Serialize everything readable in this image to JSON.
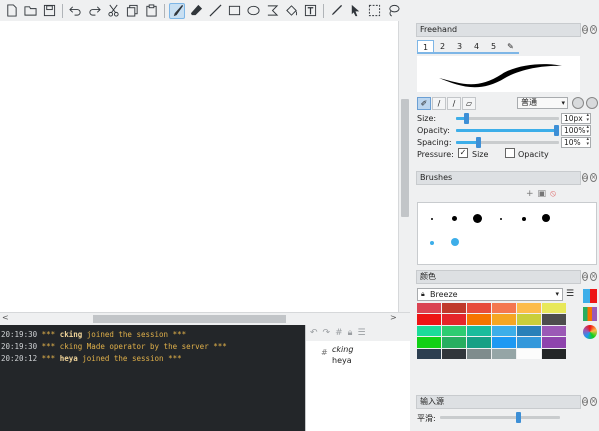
{
  "toolbar": {
    "items": [
      "new-document-icon",
      "open-folder-icon",
      "save-icon",
      "undo-icon",
      "redo-icon",
      "cut-icon",
      "copy-icon",
      "paste-icon",
      "freehand-brush-icon",
      "eraser-icon",
      "line-icon",
      "rectangle-icon",
      "ellipse-icon",
      "bezier-icon",
      "fill-bucket-icon",
      "text-icon",
      "color-picker-icon",
      "select-arrow-icon",
      "marquee-select-icon",
      "lasso-icon"
    ]
  },
  "chat": {
    "lines": [
      {
        "time": "20:19:30",
        "stars": "***",
        "user": "cking",
        "text": "joined the session",
        "end": "***"
      },
      {
        "time": "20:19:30",
        "stars": "***",
        "user": "",
        "text": "cking Made operator by the server",
        "end": "***"
      },
      {
        "time": "20:20:12",
        "stars": "***",
        "user": "heya",
        "text": "joined the session",
        "end": "***"
      }
    ]
  },
  "users": {
    "hash": "#",
    "list": [
      "cking",
      "heya"
    ]
  },
  "freehand": {
    "title": "Freehand",
    "tabs": [
      "1",
      "2",
      "3",
      "4",
      "5"
    ],
    "mode": "普通",
    "size_label": "Size:",
    "size_value": "10px",
    "size_level": 0.08,
    "opacity_label": "Opacity:",
    "opacity_value": "100%",
    "opacity_level": 1.0,
    "spacing_label": "Spacing:",
    "spacing_value": "10%",
    "spacing_level": 0.2,
    "pressure_label": "Pressure:",
    "pressure_size": "Size",
    "pressure_opacity": "Opacity",
    "pressure_size_checked": true,
    "pressure_opacity_checked": false
  },
  "brushes": {
    "title": "Brushes"
  },
  "colors": {
    "title": "颜色",
    "palette_name": "Breeze",
    "swatches": [
      "#da4453",
      "#c0392b",
      "#e74c3c",
      "#f47750",
      "#fdbc4b",
      "#e8e85a",
      "#ed1515",
      "#e5252a",
      "#f67400",
      "#f5a623",
      "#c9ce3b",
      "#4d4d4d",
      "#1cdc9a",
      "#2ecc71",
      "#1abc9c",
      "#3daee9",
      "#2980b9",
      "#9b59b6",
      "#11d116",
      "#27ae60",
      "#16a085",
      "#1d99f3",
      "#3498db",
      "#8e44ad",
      "#2c3e50",
      "#31363b",
      "#7f8c8d",
      "#95a5a6",
      "#fcfcfc",
      "#232627"
    ]
  },
  "input": {
    "title": "输入源",
    "smooth_label": "平滑:"
  }
}
